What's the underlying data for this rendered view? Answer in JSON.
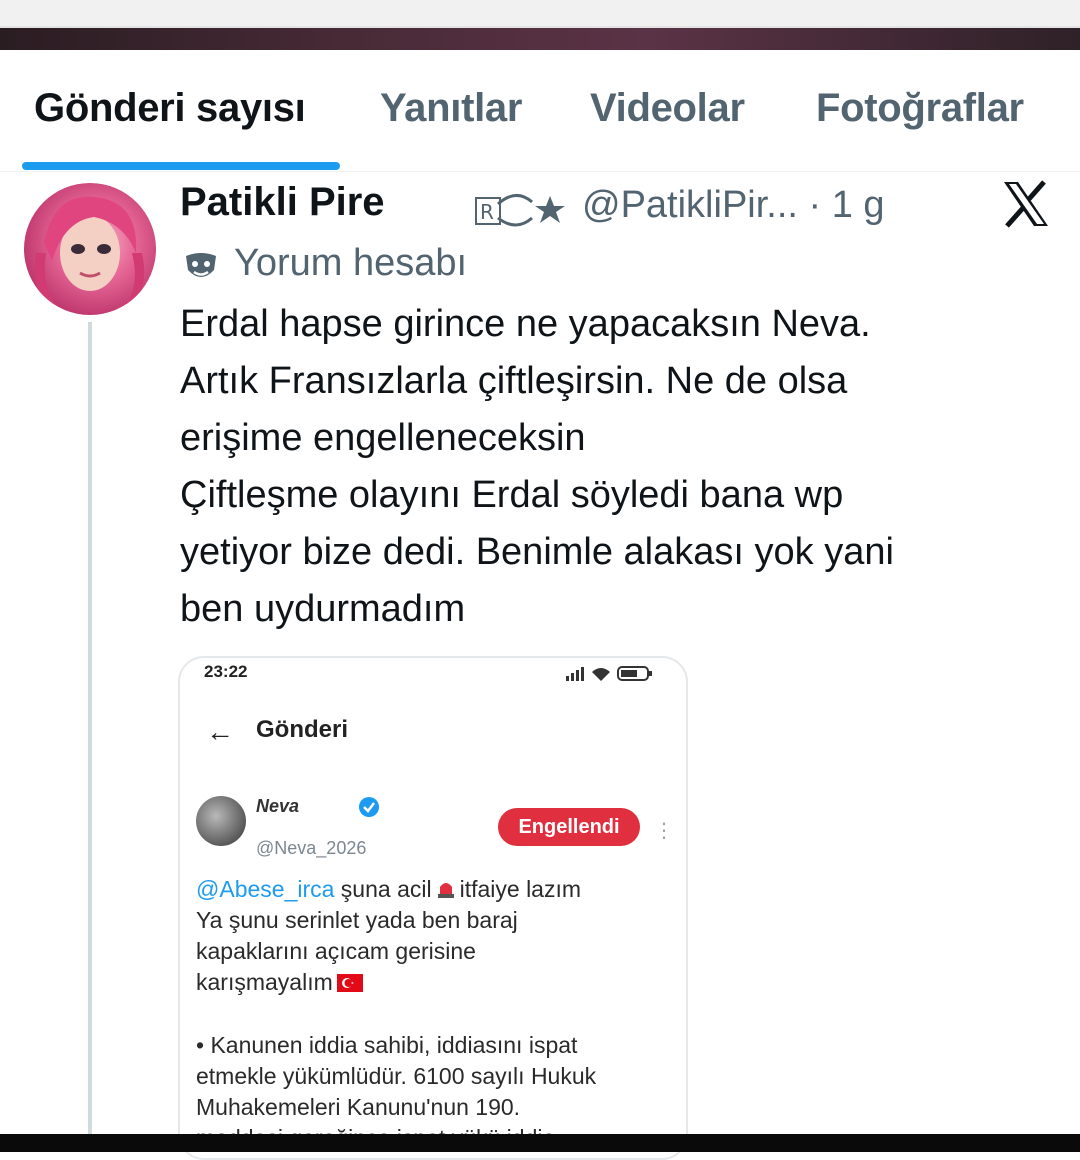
{
  "tabs": [
    {
      "label": "Gönderi sayısı",
      "active": true
    },
    {
      "label": "Yanıtlar",
      "active": false
    },
    {
      "label": "Videolar",
      "active": false
    },
    {
      "label": "Fotoğraflar",
      "active": false
    }
  ],
  "post": {
    "display_name": "Patikli Pire",
    "handle_time": "@PatikliPir... · 1 g",
    "badge_icon": "retweet-star-badge-icon",
    "label": "Yorum hesabı",
    "label_icon": "theater-masks-icon",
    "text_lines": [
      "Erdal hapse girince ne yapacaksın Neva.",
      "Artık Fransızlarla çiftleşirsin. Ne de olsa",
      "erişime engelleneceksin",
      "Çiftleşme olayını Erdal söyledi bana wp",
      "yetiyor bize dedi. Benimle alakası yok yani",
      "ben uydurmadım"
    ]
  },
  "embed": {
    "status_time": "23:22",
    "back_glyph": "←",
    "title": "Gönderi",
    "name": "Neva",
    "handle": "@Neva_2026",
    "blocked_label": "Engellendi",
    "more_glyph": "⋮",
    "mention": "@Abese_irca",
    "line1_rest": " şuna acil",
    "line1_end": "itfaiye lazım",
    "line2": "Ya şunu serinlet yada ben baraj",
    "line3": "kapaklarını açıcam gerisine",
    "line4": "karışmayalım",
    "legal_lines": [
      "• Kanunen iddia sahibi, iddiasını ispat",
      "etmekle yükümlüdür. 6100 sayılı Hukuk",
      "Muhakemeleri Kanunu'nun 190.",
      "maddesi gereğince ispat yükü iddia"
    ]
  },
  "colors": {
    "accent": "#1d9bf0",
    "secondary_text": "#536471",
    "blocked_red": "#e0303f"
  }
}
